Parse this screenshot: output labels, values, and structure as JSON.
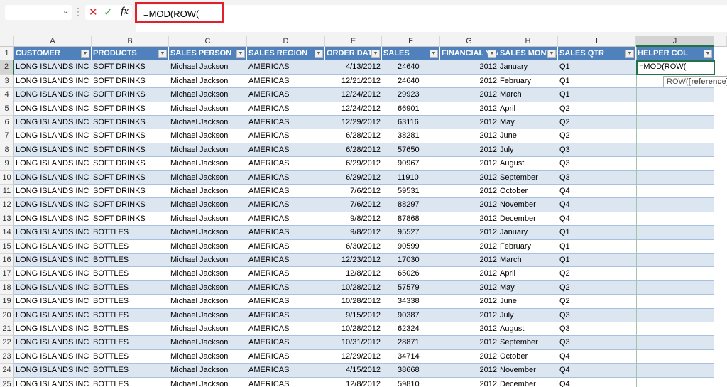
{
  "formula_bar": {
    "name_box": "",
    "cancel_icon": "✕",
    "enter_icon": "✓",
    "fx_label": "fx",
    "formula": "=MOD(ROW("
  },
  "active_cell": {
    "value": "=MOD(ROW(",
    "tooltip_fn": "ROW(",
    "tooltip_arg": "[reference]",
    "tooltip_end": ")"
  },
  "columns": [
    "A",
    "B",
    "C",
    "D",
    "E",
    "F",
    "G",
    "H",
    "I",
    "J"
  ],
  "headers": [
    "CUSTOMER",
    "PRODUCTS",
    "SALES PERSON",
    "SALES REGION",
    "ORDER DATE",
    "SALES",
    "FINANCIAL YEAR",
    "SALES MONTH",
    "SALES QTR",
    "HELPER COL"
  ],
  "rows": [
    [
      "LONG ISLANDS INC",
      "SOFT DRINKS",
      "Michael Jackson",
      "AMERICAS",
      "4/13/2012",
      "24640",
      "2012",
      "January",
      "Q1"
    ],
    [
      "LONG ISLANDS INC",
      "SOFT DRINKS",
      "Michael Jackson",
      "AMERICAS",
      "12/21/2012",
      "24640",
      "2012",
      "February",
      "Q1"
    ],
    [
      "LONG ISLANDS INC",
      "SOFT DRINKS",
      "Michael Jackson",
      "AMERICAS",
      "12/24/2012",
      "29923",
      "2012",
      "March",
      "Q1"
    ],
    [
      "LONG ISLANDS INC",
      "SOFT DRINKS",
      "Michael Jackson",
      "AMERICAS",
      "12/24/2012",
      "66901",
      "2012",
      "April",
      "Q2"
    ],
    [
      "LONG ISLANDS INC",
      "SOFT DRINKS",
      "Michael Jackson",
      "AMERICAS",
      "12/29/2012",
      "63116",
      "2012",
      "May",
      "Q2"
    ],
    [
      "LONG ISLANDS INC",
      "SOFT DRINKS",
      "Michael Jackson",
      "AMERICAS",
      "6/28/2012",
      "38281",
      "2012",
      "June",
      "Q2"
    ],
    [
      "LONG ISLANDS INC",
      "SOFT DRINKS",
      "Michael Jackson",
      "AMERICAS",
      "6/28/2012",
      "57650",
      "2012",
      "July",
      "Q3"
    ],
    [
      "LONG ISLANDS INC",
      "SOFT DRINKS",
      "Michael Jackson",
      "AMERICAS",
      "6/29/2012",
      "90967",
      "2012",
      "August",
      "Q3"
    ],
    [
      "LONG ISLANDS INC",
      "SOFT DRINKS",
      "Michael Jackson",
      "AMERICAS",
      "6/29/2012",
      "11910",
      "2012",
      "September",
      "Q3"
    ],
    [
      "LONG ISLANDS INC",
      "SOFT DRINKS",
      "Michael Jackson",
      "AMERICAS",
      "7/6/2012",
      "59531",
      "2012",
      "October",
      "Q4"
    ],
    [
      "LONG ISLANDS INC",
      "SOFT DRINKS",
      "Michael Jackson",
      "AMERICAS",
      "7/6/2012",
      "88297",
      "2012",
      "November",
      "Q4"
    ],
    [
      "LONG ISLANDS INC",
      "SOFT DRINKS",
      "Michael Jackson",
      "AMERICAS",
      "9/8/2012",
      "87868",
      "2012",
      "December",
      "Q4"
    ],
    [
      "LONG ISLANDS INC",
      "BOTTLES",
      "Michael Jackson",
      "AMERICAS",
      "9/8/2012",
      "95527",
      "2012",
      "January",
      "Q1"
    ],
    [
      "LONG ISLANDS INC",
      "BOTTLES",
      "Michael Jackson",
      "AMERICAS",
      "6/30/2012",
      "90599",
      "2012",
      "February",
      "Q1"
    ],
    [
      "LONG ISLANDS INC",
      "BOTTLES",
      "Michael Jackson",
      "AMERICAS",
      "12/23/2012",
      "17030",
      "2012",
      "March",
      "Q1"
    ],
    [
      "LONG ISLANDS INC",
      "BOTTLES",
      "Michael Jackson",
      "AMERICAS",
      "12/8/2012",
      "65026",
      "2012",
      "April",
      "Q2"
    ],
    [
      "LONG ISLANDS INC",
      "BOTTLES",
      "Michael Jackson",
      "AMERICAS",
      "10/28/2012",
      "57579",
      "2012",
      "May",
      "Q2"
    ],
    [
      "LONG ISLANDS INC",
      "BOTTLES",
      "Michael Jackson",
      "AMERICAS",
      "10/28/2012",
      "34338",
      "2012",
      "June",
      "Q2"
    ],
    [
      "LONG ISLANDS INC",
      "BOTTLES",
      "Michael Jackson",
      "AMERICAS",
      "9/15/2012",
      "90387",
      "2012",
      "July",
      "Q3"
    ],
    [
      "LONG ISLANDS INC",
      "BOTTLES",
      "Michael Jackson",
      "AMERICAS",
      "10/28/2012",
      "62324",
      "2012",
      "August",
      "Q3"
    ],
    [
      "LONG ISLANDS INC",
      "BOTTLES",
      "Michael Jackson",
      "AMERICAS",
      "10/31/2012",
      "28871",
      "2012",
      "September",
      "Q3"
    ],
    [
      "LONG ISLANDS INC",
      "BOTTLES",
      "Michael Jackson",
      "AMERICAS",
      "12/29/2012",
      "34714",
      "2012",
      "October",
      "Q4"
    ],
    [
      "LONG ISLANDS INC",
      "BOTTLES",
      "Michael Jackson",
      "AMERICAS",
      "4/15/2012",
      "38668",
      "2012",
      "November",
      "Q4"
    ],
    [
      "LONG ISLANDS INC",
      "BOTTLES",
      "Michael Jackson",
      "AMERICAS",
      "12/8/2012",
      "59810",
      "2012",
      "December",
      "Q4"
    ]
  ],
  "colors": {
    "header": "#4f81bd",
    "band": "#dce6f1",
    "accent": "#217346",
    "highlight": "#e0202b"
  }
}
